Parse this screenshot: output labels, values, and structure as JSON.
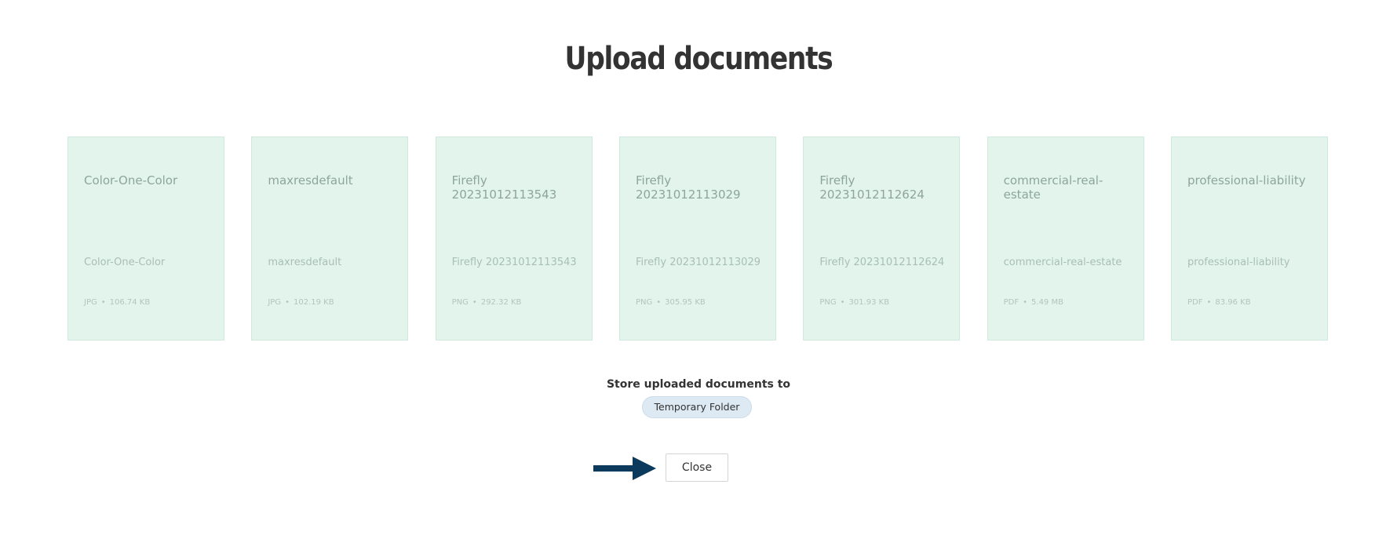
{
  "title": "Upload documents",
  "colors": {
    "card_bg": "#e3f4ec",
    "card_border": "#cfe9dc",
    "pill_bg": "#dde9f3",
    "arrow": "#0b3a5c"
  },
  "documents": [
    {
      "title": "Color-One-Color",
      "name": "Color-One-Color",
      "type": "JPG",
      "size": "106.74 KB"
    },
    {
      "title": "maxresdefault",
      "name": "maxresdefault",
      "type": "JPG",
      "size": "102.19 KB"
    },
    {
      "title": "Firefly 20231012113543",
      "name": "Firefly 20231012113543",
      "type": "PNG",
      "size": "292.32 KB"
    },
    {
      "title": "Firefly 20231012113029",
      "name": "Firefly 20231012113029",
      "type": "PNG",
      "size": "305.95 KB"
    },
    {
      "title": "Firefly 20231012112624",
      "name": "Firefly 20231012112624",
      "type": "PNG",
      "size": "301.93 KB"
    },
    {
      "title": "commercial-real-estate",
      "name": "commercial-real-estate",
      "type": "PDF",
      "size": "5.49 MB"
    },
    {
      "title": "professional-liability",
      "name": "professional-liability",
      "type": "PDF",
      "size": "83.96 KB"
    }
  ],
  "store": {
    "label": "Store uploaded documents to",
    "folder": "Temporary Folder"
  },
  "close_label": "Close",
  "icons": {
    "pointer": "arrow-right-icon",
    "separator": "•"
  }
}
